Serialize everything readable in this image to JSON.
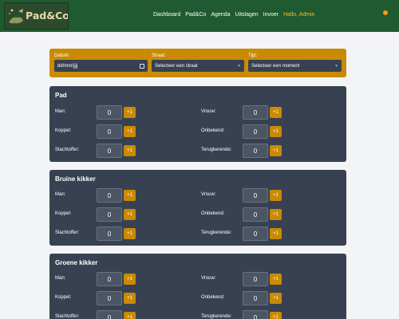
{
  "header": {
    "logo_text": "Pad&Co",
    "nav": [
      "Dashboard",
      "Pad&Co",
      "Agenda",
      "Uitslagen",
      "Invoer"
    ],
    "greeting": "Hallo, Admin"
  },
  "filters": {
    "date": {
      "label": "Datum:",
      "value": "dd/mm/jjjj"
    },
    "street": {
      "label": "Straat:",
      "value": "Selecteer een straat"
    },
    "time": {
      "label": "Tijd:",
      "value": "Selecteer een moment"
    }
  },
  "labels": {
    "man": "Man:",
    "vrouw": "Vrouw:",
    "koppel": "Koppel:",
    "onbekend": "Onbekend:",
    "slachtoffer": "Slachtoffer:",
    "terugkerende": "Terugkerende:"
  },
  "plus_label": "+1",
  "species": [
    {
      "title": "Pad",
      "man": "0",
      "vrouw": "0",
      "koppel": "0",
      "onbekend": "0",
      "slachtoffer": "0",
      "terugkerende": "0"
    },
    {
      "title": "Bruine kikker",
      "man": "0",
      "vrouw": "0",
      "koppel": "0",
      "onbekend": "0",
      "slachtoffer": "0",
      "terugkerende": "0"
    },
    {
      "title": "Groene kikker",
      "man": "0",
      "vrouw": "0",
      "koppel": "0",
      "onbekend": "0",
      "slachtoffer": "0",
      "terugkerende": "0"
    }
  ]
}
